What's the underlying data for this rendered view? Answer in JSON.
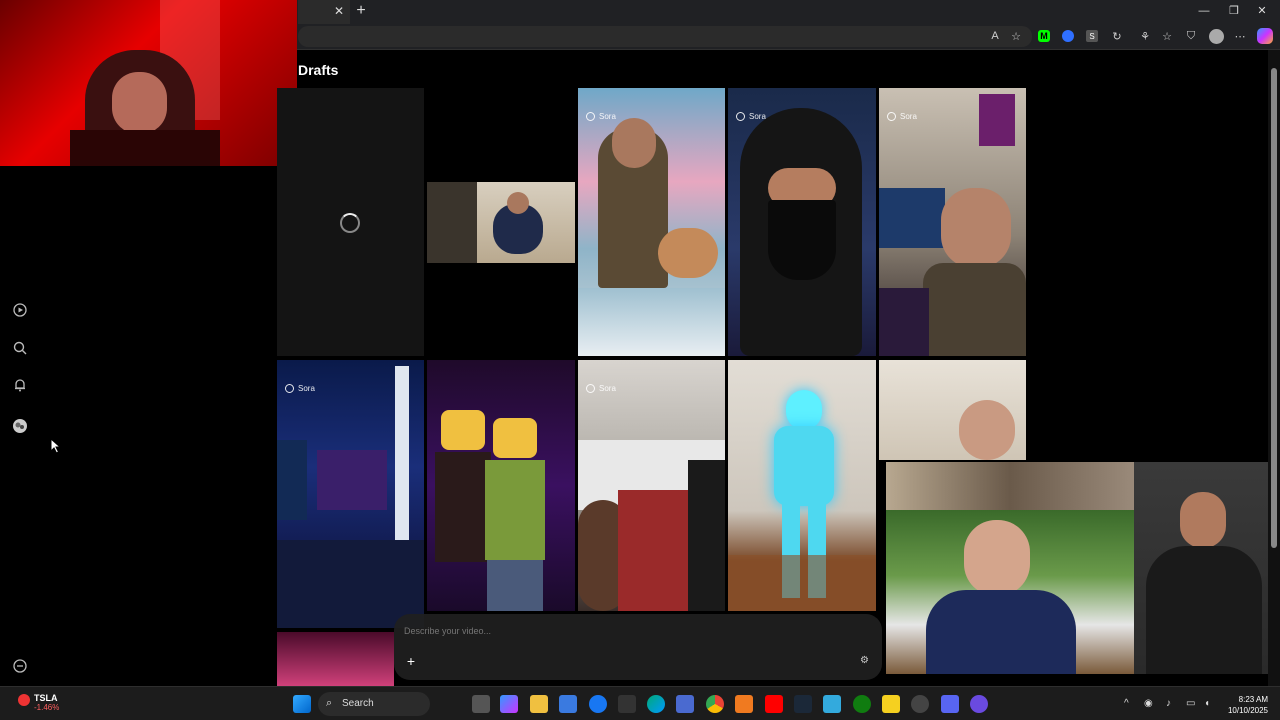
{
  "browser": {
    "tab_close": "✕",
    "new_tab": "+",
    "minimize": "—",
    "restore": "❐",
    "close": "✕",
    "toolbar_icons": [
      "read-aloud-icon",
      "favorite-star-icon",
      "extension-m-icon",
      "extension-blue-icon",
      "extension-s-icon",
      "refresh-ext-icon",
      "extension-icon",
      "favorites-icon",
      "browser-essentials-icon",
      "profile-icon",
      "more-icon",
      "copilot-icon"
    ]
  },
  "page": {
    "title": "Drafts"
  },
  "sidebar": {
    "icons": [
      "explore-icon",
      "search-icon",
      "notifications-icon",
      "profile-avatar-icon",
      "settings-icon"
    ]
  },
  "tiles": [
    {
      "badge": "",
      "loading": true
    },
    {
      "badge": ""
    },
    {
      "badge": "Sora"
    },
    {
      "badge": "Sora"
    },
    {
      "badge": "Sora"
    },
    {
      "badge": "Sora"
    },
    {
      "badge": ""
    },
    {
      "badge": "Sora"
    },
    {
      "badge": ""
    },
    {
      "badge": ""
    }
  ],
  "composer": {
    "placeholder": "Describe your video...",
    "plus": "+",
    "settings": "⚙"
  },
  "taskbar": {
    "stock_name": "TSLA",
    "stock_change": "-1.46%",
    "search_label": "Search",
    "time": "8:23 AM",
    "date": "10/10/2025"
  }
}
